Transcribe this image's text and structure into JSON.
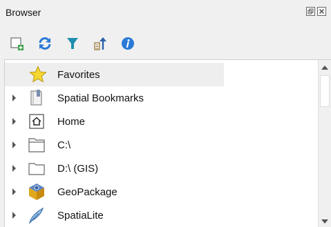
{
  "panel": {
    "title": "Browser",
    "float_icon": "float-panel-icon",
    "close_icon": "close-panel-icon"
  },
  "toolbar": {
    "buttons": [
      {
        "icon": "add-selected-layers-icon"
      },
      {
        "icon": "refresh-icon"
      },
      {
        "icon": "filter-icon"
      },
      {
        "icon": "collapse-all-icon"
      },
      {
        "icon": "properties-info-icon"
      }
    ]
  },
  "tree": {
    "items": [
      {
        "label": "Favorites",
        "icon": "star-icon",
        "expandable": false,
        "selected": true
      },
      {
        "label": "Spatial Bookmarks",
        "icon": "bookmark-icon",
        "expandable": true
      },
      {
        "label": "Home",
        "icon": "home-icon",
        "expandable": true
      },
      {
        "label": "C:\\",
        "icon": "drive-folder-icon",
        "expandable": true
      },
      {
        "label": "D:\\ (GIS)",
        "icon": "folder-icon",
        "expandable": true
      },
      {
        "label": "GeoPackage",
        "icon": "geopackage-icon",
        "expandable": true
      },
      {
        "label": "SpatiaLite",
        "icon": "spatialite-feather-icon",
        "expandable": true
      }
    ]
  },
  "colors": {
    "accent_blue": "#2a7ad6",
    "filter_teal": "#1f8fb0",
    "star_yellow": "#f5d633",
    "selection": "#eeeeee"
  }
}
